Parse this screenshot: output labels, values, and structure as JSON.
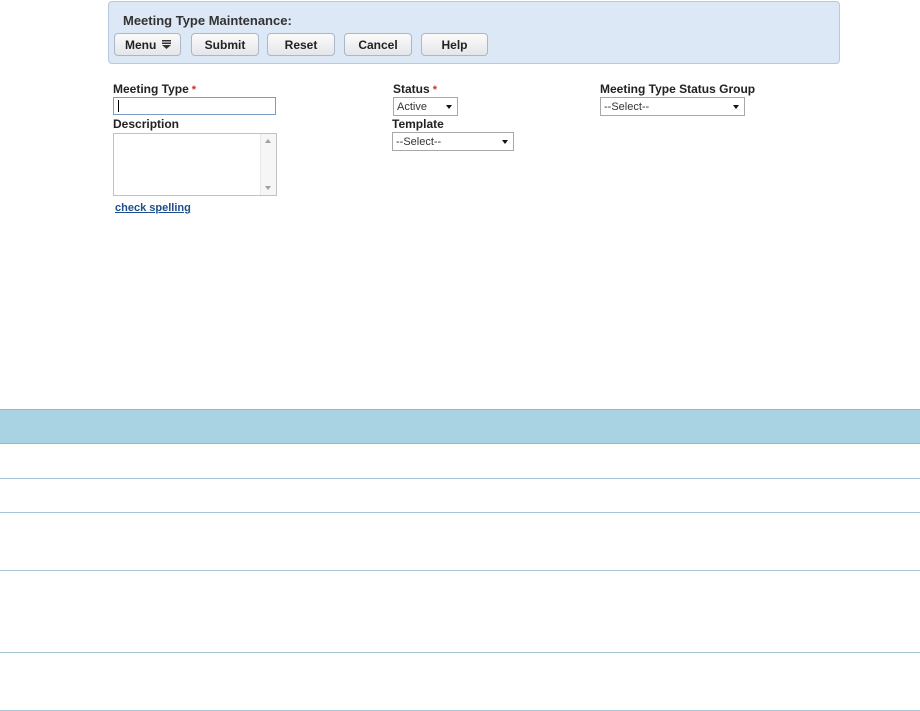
{
  "panel": {
    "title": "Meeting Type Maintenance:",
    "buttons": {
      "menu": "Menu",
      "submit": "Submit",
      "reset": "Reset",
      "cancel": "Cancel",
      "help": "Help"
    }
  },
  "form": {
    "meeting_type": {
      "label": "Meeting Type",
      "required_marker": "*",
      "value": ""
    },
    "description": {
      "label": "Description",
      "value": ""
    },
    "check_spelling_link": "check spelling",
    "status": {
      "label": "Status",
      "required_marker": "*",
      "selected": "Active"
    },
    "template": {
      "label": "Template",
      "selected": "--Select--"
    },
    "status_group": {
      "label": "Meeting Type Status Group",
      "selected": "--Select--"
    }
  },
  "colors": {
    "panel_bg": "#dce8f5",
    "grid_header_bg": "#a9d3e3",
    "required": "#d0311f",
    "link": "#1f4e8c"
  },
  "grid": {
    "rows": 5
  }
}
